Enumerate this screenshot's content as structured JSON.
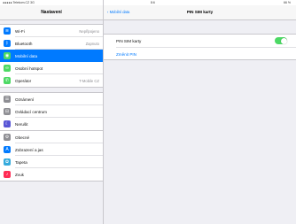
{
  "status_bar": {
    "carrier": "●●●●● Telekom.CZ 3G",
    "time": "8:6",
    "battery": "66 %"
  },
  "sidebar": {
    "title": "Nastavení",
    "groups": [
      {
        "items": [
          {
            "label": "Wi-Fi",
            "value": "Nepřipojeno",
            "icon": "wifi-icon",
            "color": "#007aff",
            "glyph": "≋"
          },
          {
            "label": "Bluetooth",
            "value": "Zapnuto",
            "icon": "bluetooth-icon",
            "color": "#007aff",
            "glyph": "ᛒ"
          },
          {
            "label": "Mobilní data",
            "value": "",
            "icon": "antenna-icon",
            "color": "#4cd964",
            "glyph": "◉",
            "selected": true
          },
          {
            "label": "Osobní hotspot",
            "value": "",
            "icon": "hotspot-icon",
            "color": "#4cd964",
            "glyph": "∞"
          },
          {
            "label": "Operátor",
            "value": "T-Mobile CZ",
            "icon": "phone-icon",
            "color": "#4cd964",
            "glyph": "✆"
          }
        ]
      },
      {
        "items": [
          {
            "label": "Oznámení",
            "icon": "notifications-icon",
            "color": "#8e8e93",
            "glyph": "☰"
          },
          {
            "label": "Ovládací centrum",
            "icon": "control-center-icon",
            "color": "#8e8e93",
            "glyph": "⊟"
          },
          {
            "label": "Nerušit",
            "icon": "moon-icon",
            "color": "#5856d6",
            "glyph": "☾"
          }
        ]
      },
      {
        "items": [
          {
            "label": "Obecné",
            "icon": "gear-icon",
            "color": "#8e8e93",
            "glyph": "⚙"
          },
          {
            "label": "Zobrazení a jas",
            "icon": "brightness-icon",
            "color": "#007aff",
            "glyph": "A"
          },
          {
            "label": "Tapeta",
            "icon": "wallpaper-icon",
            "color": "#34aadc",
            "glyph": "✿"
          },
          {
            "label": "Zvuk",
            "icon": "sound-icon",
            "color": "#ff2d55",
            "glyph": "♪"
          }
        ]
      }
    ]
  },
  "detail": {
    "back_label": "Mobilní data",
    "title": "PIN SIM karty",
    "sim_pin_label": "PIN SIM karty",
    "sim_pin_enabled": true,
    "change_pin_label": "Změnit PIN"
  }
}
